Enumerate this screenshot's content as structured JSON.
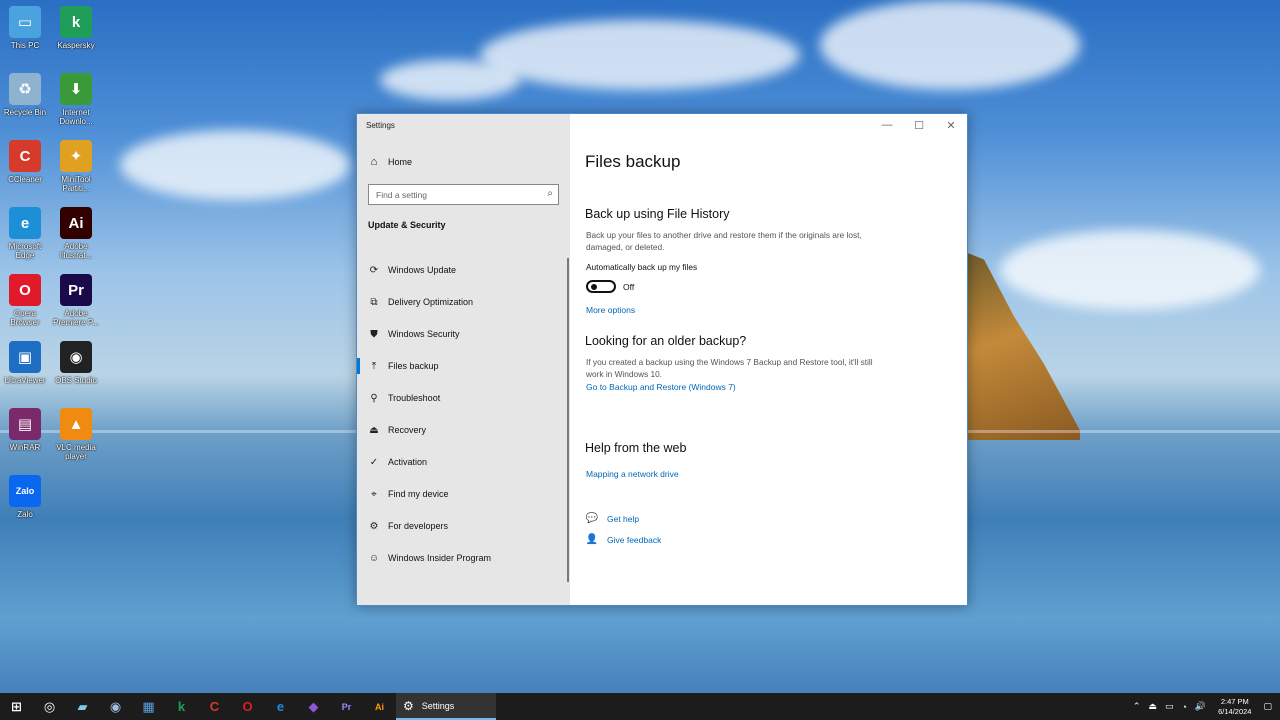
{
  "desktop": {
    "icons": [
      {
        "label": "This PC",
        "icon": "computer-icon",
        "color": "#4aa3df"
      },
      {
        "label": "Kaspersky",
        "icon": "kaspersky-icon",
        "color": "#1f9e5a"
      },
      {
        "label": "Recycle Bin",
        "icon": "recycle-bin-icon",
        "color": "#8fb3cf"
      },
      {
        "label": "Internet Downlo...",
        "icon": "idm-icon",
        "color": "#3a9a3a"
      },
      {
        "label": "CCleaner",
        "icon": "ccleaner-icon",
        "color": "#d63a2a"
      },
      {
        "label": "MiniTool Partiti...",
        "icon": "minitool-icon",
        "color": "#e0a020"
      },
      {
        "label": "Microsoft Edge",
        "icon": "edge-icon",
        "color": "#1c8fd6"
      },
      {
        "label": "Adobe Illustrat...",
        "icon": "illustrator-icon",
        "color": "#330000"
      },
      {
        "label": "Opera Browser",
        "icon": "opera-icon",
        "color": "#e01a2a"
      },
      {
        "label": "Adobe Premiere P...",
        "icon": "premiere-icon",
        "color": "#1a0a4a"
      },
      {
        "label": "UltraViewer",
        "icon": "ultraviewer-icon",
        "color": "#1e6fc4"
      },
      {
        "label": "OBS Studio",
        "icon": "obs-icon",
        "color": "#222222"
      },
      {
        "label": "WinRAR",
        "icon": "winrar-icon",
        "color": "#7a2a6a"
      },
      {
        "label": "VLC media player",
        "icon": "vlc-icon",
        "color": "#f08a10"
      },
      {
        "label": "Zalo",
        "icon": "zalo-icon",
        "color": "#0a68f0"
      }
    ]
  },
  "window": {
    "title": "Settings",
    "controls": {
      "minimize": "—",
      "maximize": "☐",
      "close": "✕"
    }
  },
  "sidebar": {
    "home_label": "Home",
    "search_placeholder": "Find a setting",
    "section_title": "Update & Security",
    "items": [
      {
        "label": "Windows Update",
        "icon": "sync-icon"
      },
      {
        "label": "Delivery Optimization",
        "icon": "delivery-icon"
      },
      {
        "label": "Windows Security",
        "icon": "shield-icon"
      },
      {
        "label": "Files backup",
        "icon": "upload-arrow-icon"
      },
      {
        "label": "Troubleshoot",
        "icon": "wrench-icon"
      },
      {
        "label": "Recovery",
        "icon": "recovery-icon"
      },
      {
        "label": "Activation",
        "icon": "check-circle-icon"
      },
      {
        "label": "Find my device",
        "icon": "find-device-icon"
      },
      {
        "label": "For developers",
        "icon": "developer-icon"
      },
      {
        "label": "Windows Insider Program",
        "icon": "insider-icon"
      }
    ],
    "active_index": 3
  },
  "main": {
    "title": "Files backup",
    "file_history": {
      "heading": "Back up using File History",
      "description": "Back up your files to another drive and restore them if the originals are lost, damaged, or deleted.",
      "toggle_label": "Automatically back up my files",
      "toggle_state": "Off",
      "more_options": "More options"
    },
    "older_backup": {
      "heading": "Looking for an older backup?",
      "description": "If you created a backup using the Windows 7 Backup and Restore tool, it'll still work in Windows 10.",
      "link": "Go to Backup and Restore (Windows 7)"
    },
    "help_web": {
      "heading": "Help from the web",
      "link": "Mapping a network drive"
    },
    "get_help": "Get help",
    "give_feedback": "Give feedback"
  },
  "taskbar": {
    "active_app": "Settings",
    "pinned": [
      {
        "glyph": "◎",
        "icon": "cortana-icon",
        "color": "#ffffff"
      },
      {
        "glyph": "▰",
        "icon": "notepad-icon",
        "color": "#7fc8f0"
      },
      {
        "glyph": "◉",
        "icon": "camera-icon",
        "color": "#9fbfe0"
      },
      {
        "glyph": "▦",
        "icon": "calculator-icon",
        "color": "#5aa0e0"
      },
      {
        "glyph": "k",
        "icon": "kaspersky-icon",
        "color": "#1f9e5a"
      },
      {
        "glyph": "C",
        "icon": "ccleaner-icon",
        "color": "#d63a2a"
      },
      {
        "glyph": "O",
        "icon": "opera-icon",
        "color": "#e01a2a"
      },
      {
        "glyph": "e",
        "icon": "edge-icon",
        "color": "#1c8fd6"
      },
      {
        "glyph": "◆",
        "icon": "visual-studio-icon",
        "color": "#8a5ad6"
      },
      {
        "glyph": "Pr",
        "icon": "premiere-icon",
        "color": "#9a8aff"
      },
      {
        "glyph": "Ai",
        "icon": "illustrator-icon",
        "color": "#ff9a00"
      }
    ],
    "time": "2:47 PM",
    "date": "6/14/2024"
  }
}
